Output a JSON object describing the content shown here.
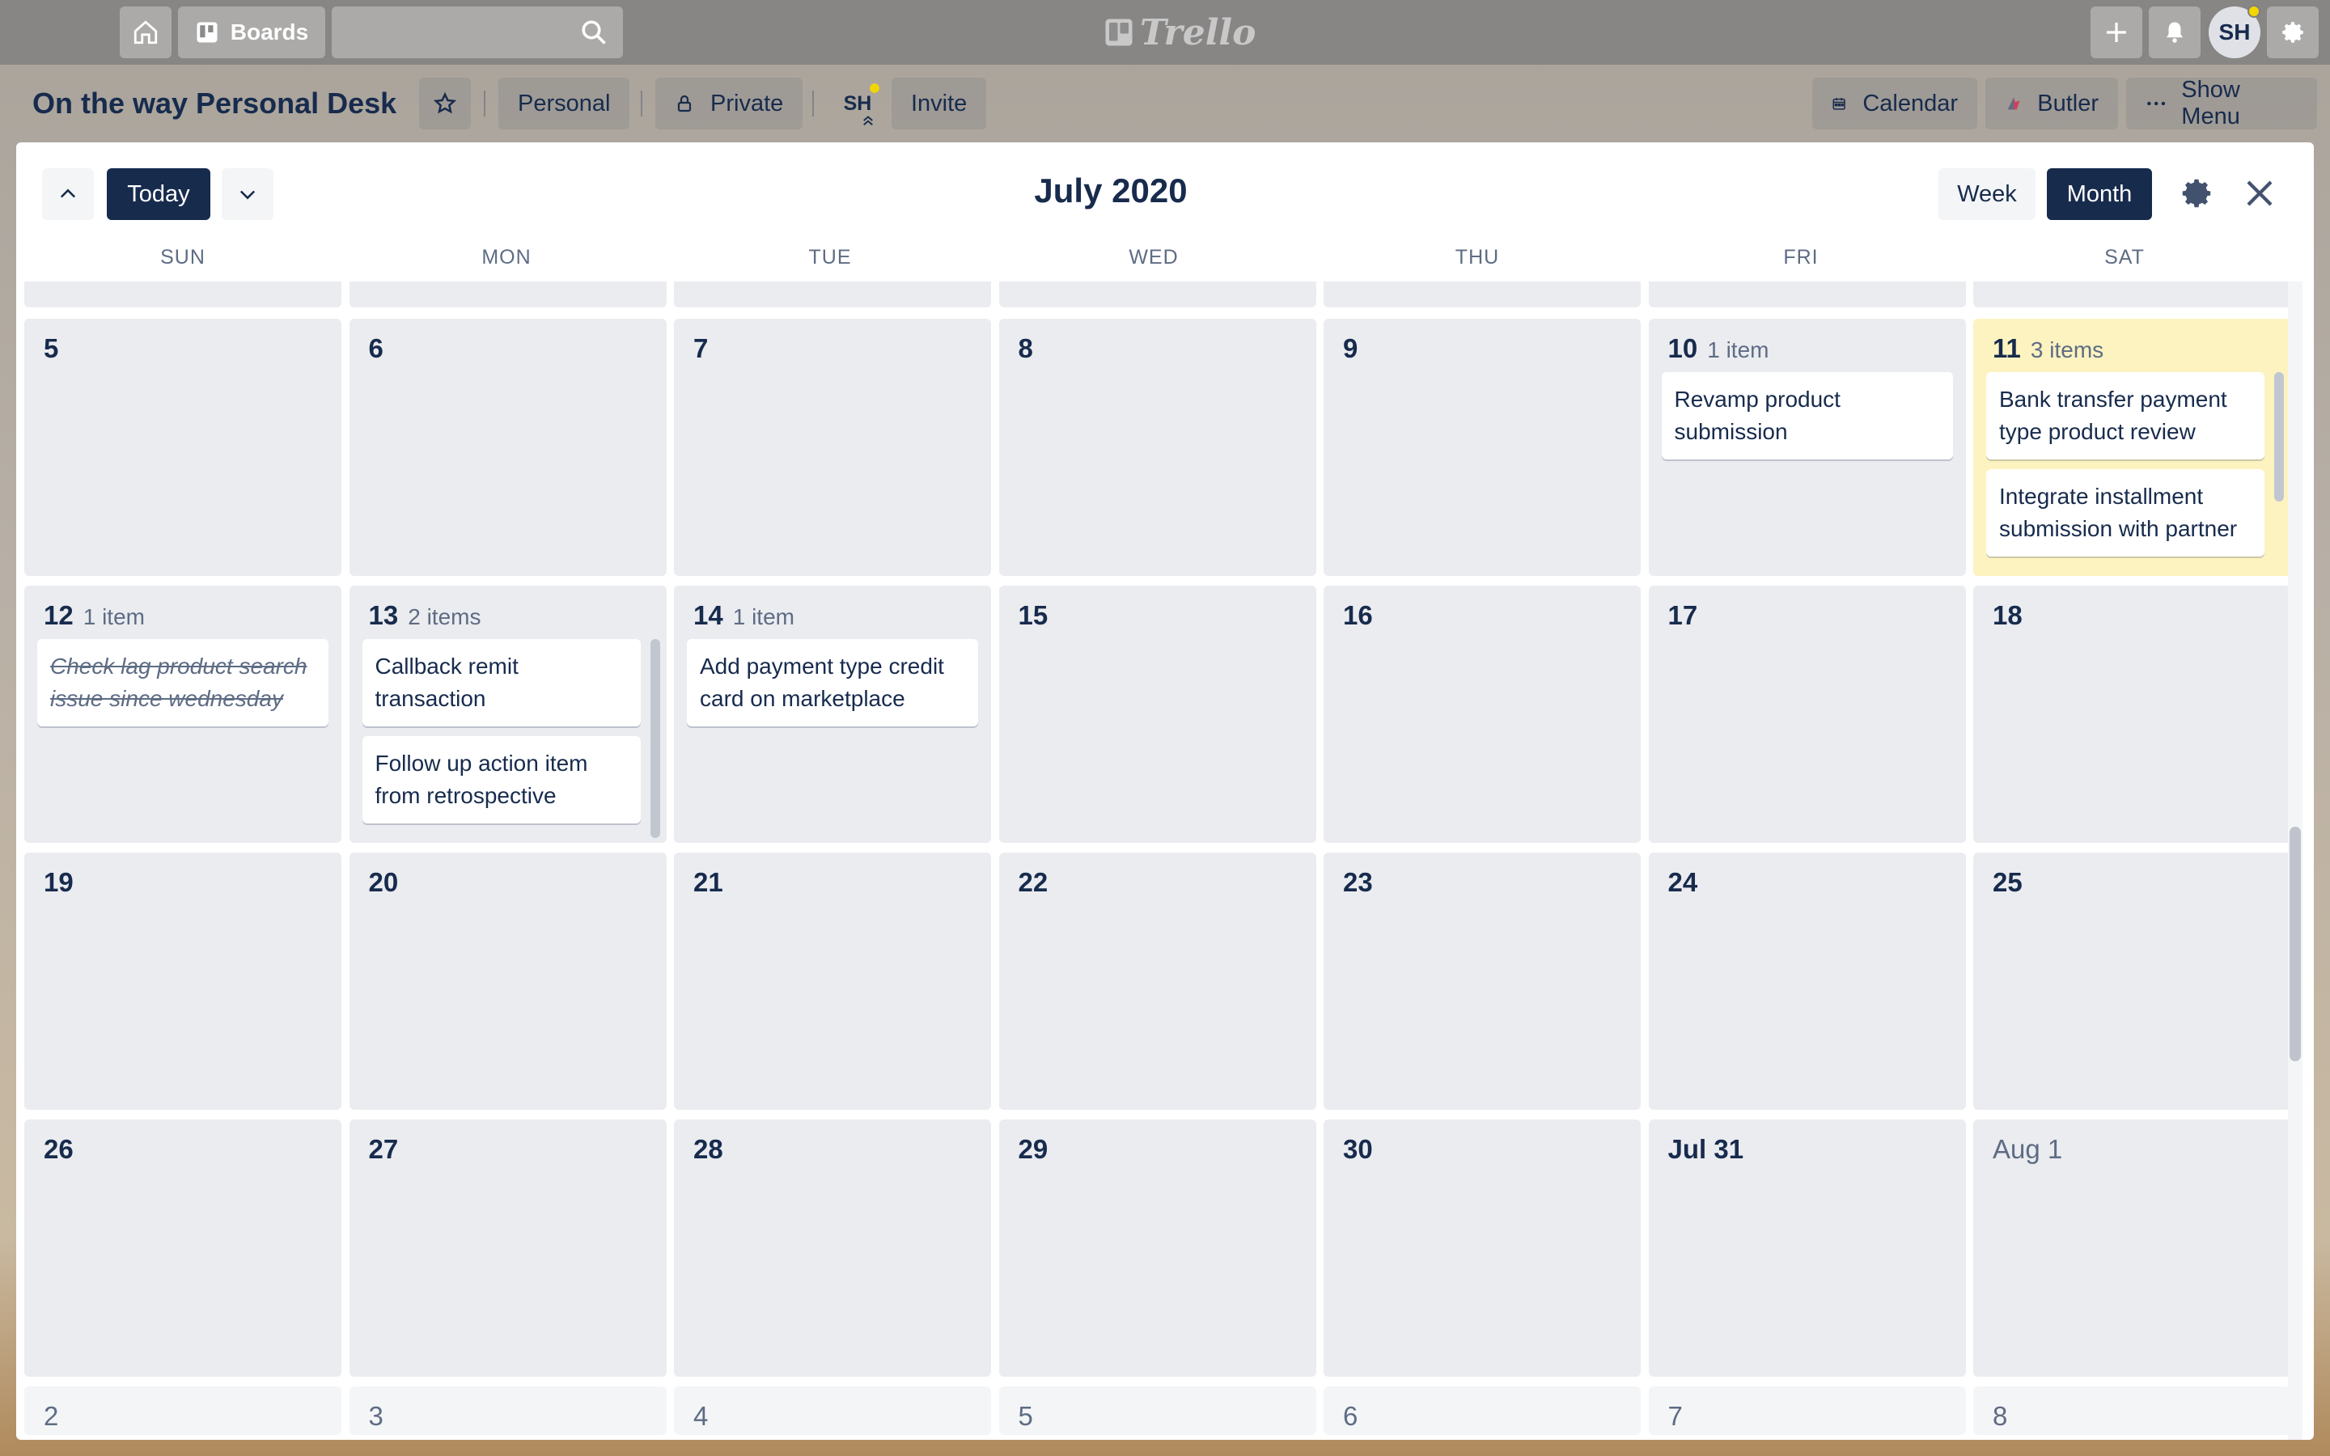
{
  "header": {
    "boards_label": "Boards",
    "search_placeholder": "",
    "logo_text": "Trello",
    "user_initials": "SH"
  },
  "board": {
    "title": "On the way Personal Desk",
    "team_label": "Personal",
    "visibility_label": "Private",
    "member_initials": "SH",
    "invite_label": "Invite",
    "calendar_label": "Calendar",
    "butler_label": "Butler",
    "menu_label": "Show Menu"
  },
  "calendar": {
    "title": "July 2020",
    "today_label": "Today",
    "week_label": "Week",
    "month_label": "Month",
    "weekdays": [
      "SUN",
      "MON",
      "TUE",
      "WED",
      "THU",
      "FRI",
      "SAT"
    ],
    "weeks": [
      [
        {
          "day": "5"
        },
        {
          "day": "6"
        },
        {
          "day": "7"
        },
        {
          "day": "8"
        },
        {
          "day": "9"
        },
        {
          "day": "10",
          "count": "1 item",
          "cards": [
            {
              "text": "Revamp product submission"
            }
          ]
        },
        {
          "day": "11",
          "count": "3 items",
          "highlight": true,
          "scroll": true,
          "cards": [
            {
              "text": "Bank transfer payment type product review"
            },
            {
              "text": "Integrate installment submission with partner"
            }
          ]
        }
      ],
      [
        {
          "day": "12",
          "count": "1 item",
          "cards": [
            {
              "text": "Check lag product search issue since wednesday",
              "done": true
            }
          ]
        },
        {
          "day": "13",
          "count": "2 items",
          "scroll": true,
          "cards": [
            {
              "text": "Callback remit transaction"
            },
            {
              "text": "Follow up action item from retrospective"
            }
          ]
        },
        {
          "day": "14",
          "count": "1 item",
          "cards": [
            {
              "text": "Add payment type credit card on marketplace"
            }
          ]
        },
        {
          "day": "15"
        },
        {
          "day": "16"
        },
        {
          "day": "17"
        },
        {
          "day": "18"
        }
      ],
      [
        {
          "day": "19"
        },
        {
          "day": "20"
        },
        {
          "day": "21"
        },
        {
          "day": "22"
        },
        {
          "day": "23"
        },
        {
          "day": "24"
        },
        {
          "day": "25"
        }
      ],
      [
        {
          "day": "26"
        },
        {
          "day": "27"
        },
        {
          "day": "28"
        },
        {
          "day": "29"
        },
        {
          "day": "30"
        },
        {
          "day": "Jul 31"
        },
        {
          "day": "Aug 1",
          "other": true
        }
      ],
      [
        {
          "day": "2",
          "other": true
        },
        {
          "day": "3",
          "other": true
        },
        {
          "day": "4",
          "other": true
        },
        {
          "day": "5",
          "other": true
        },
        {
          "day": "6",
          "other": true
        },
        {
          "day": "7",
          "other": true
        },
        {
          "day": "8",
          "other": true
        }
      ]
    ]
  }
}
